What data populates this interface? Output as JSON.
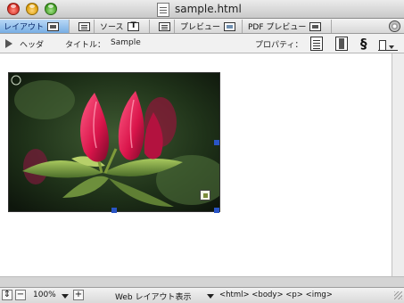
{
  "window": {
    "title": "sample.html"
  },
  "mode_tabs": [
    {
      "label": "レイアウト",
      "icon": "layout-icon"
    },
    {
      "label": "",
      "icon": "table-icon"
    },
    {
      "label": "ソース",
      "icon": "text-icon"
    },
    {
      "label": "",
      "icon": "list-icon"
    },
    {
      "label": "プレビュー",
      "icon": "preview-icon"
    },
    {
      "label": "PDF プレビュー",
      "icon": "pdf-icon"
    }
  ],
  "info_bar": {
    "head_label": "ヘッダ",
    "title_label": "タイトル：",
    "title_value": "Sample",
    "properties_label": "プロパティ："
  },
  "status_bar": {
    "zoom": "100%",
    "view_mode": "Web レイアウト表示",
    "breadcrumb": "<html>  <body>  <p>  <img>"
  },
  "colors": {
    "active_tab": "#78aee4",
    "selection_handle": "#2a55c6"
  }
}
